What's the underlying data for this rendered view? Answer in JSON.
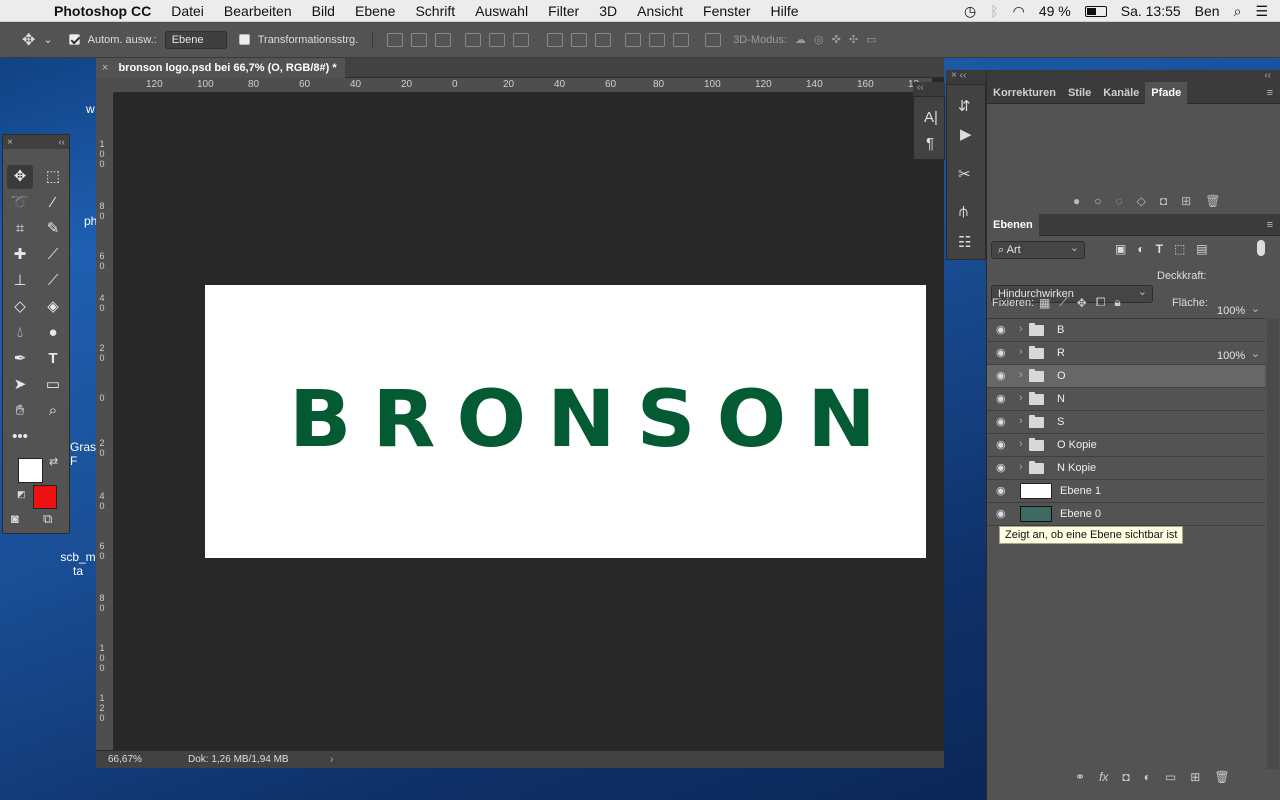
{
  "menubar": {
    "apple": "",
    "app": "Photoshop CC",
    "items": [
      "Datei",
      "Bearbeiten",
      "Bild",
      "Ebene",
      "Schrift",
      "Auswahl",
      "Filter",
      "3D",
      "Ansicht",
      "Fenster",
      "Hilfe"
    ],
    "battery": "49 %",
    "clock": "Sa. 13:55",
    "user": "Ben"
  },
  "options": {
    "auto_select_label": "Autom. ausw.:",
    "auto_select_target": "Ebene",
    "transform_label": "Transformationsstrg.",
    "mode3d": "3D-Modus:"
  },
  "document": {
    "tab_title": "bronson logo.psd bei 66,7% (O, RGB/8#) *",
    "logo_text": "BRONSON",
    "logo_color": "#045a32",
    "h_ruler": [
      "120",
      "100",
      "80",
      "60",
      "40",
      "20",
      "0",
      "20",
      "40",
      "60",
      "80",
      "100",
      "120",
      "140",
      "160",
      "18"
    ],
    "v_ruler": [
      "1 0 0",
      "8 0",
      "6 0",
      "4 0",
      "2 0",
      "0",
      "2 0",
      "4 0",
      "6 0",
      "8 0",
      "1 0 0",
      "1 2 0"
    ],
    "zoom": "66,67%",
    "doc_info": "Dok: 1,26 MB/1,94 MB"
  },
  "desktop": {
    "labels": [
      "w",
      "ph",
      "Gras F",
      "scb_m ta"
    ]
  },
  "panels": {
    "top_tabs": [
      "Korrekturen",
      "Stile",
      "Kanäle",
      "Pfade"
    ],
    "layers_tab": "Ebenen",
    "filter_kind": "Art",
    "blend_mode": "Hindurchwirken",
    "opacity_label": "Deckkraft:",
    "opacity": "100%",
    "lock_label": "Fixieren:",
    "fill_label": "Fläche:",
    "fill": "100%",
    "layers": [
      {
        "name": "B",
        "type": "group",
        "selected": false
      },
      {
        "name": "R",
        "type": "group",
        "selected": false
      },
      {
        "name": "O",
        "type": "group",
        "selected": true
      },
      {
        "name": "N",
        "type": "group",
        "selected": false
      },
      {
        "name": "S",
        "type": "group",
        "selected": false
      },
      {
        "name": "O Kopie",
        "type": "group",
        "selected": false
      },
      {
        "name": "N Kopie",
        "type": "group",
        "selected": false
      },
      {
        "name": "Ebene 1",
        "type": "pixel",
        "selected": false
      },
      {
        "name": "Ebene 0",
        "type": "pixel",
        "selected": false
      }
    ],
    "tooltip": "Zeigt an, ob eine Ebene sichtbar ist"
  },
  "colors": {
    "foreground": "#ffffff",
    "background": "#ee1111"
  }
}
